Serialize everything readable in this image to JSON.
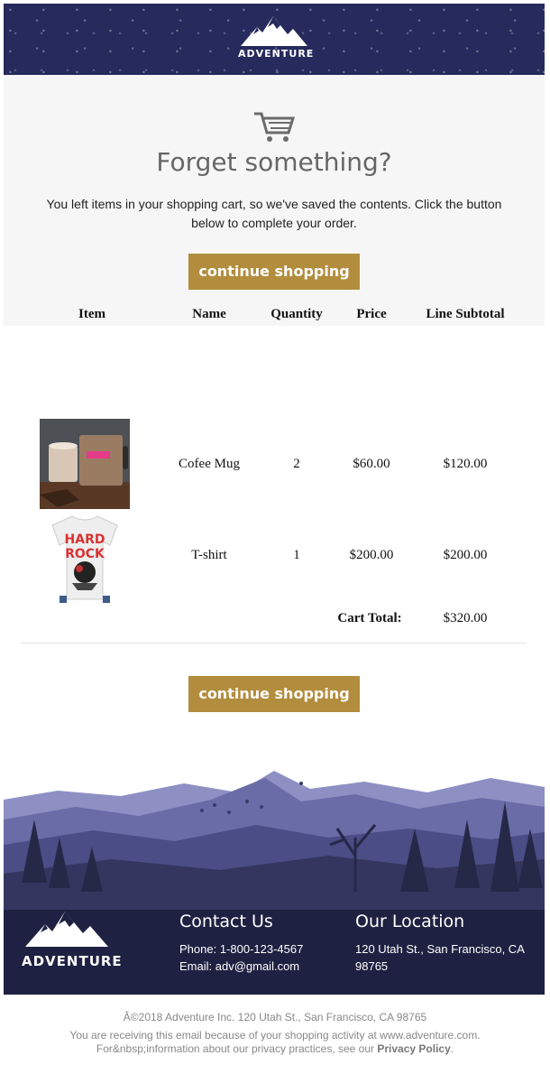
{
  "header": {
    "brand": "ADVENTURE",
    "logo_icon": "mountain-logo-icon"
  },
  "hero": {
    "icon": "shopping-cart-icon",
    "title": "Forget something?",
    "message": "You left items in your shopping cart, so we've saved the contents. Click the button below to complete your order.",
    "button_label": "continue shopping"
  },
  "cart": {
    "columns": [
      "Item",
      "Name",
      "Quantity",
      "Price",
      "Line Subtotal"
    ],
    "rows": [
      {
        "image": "coffee-mug-photo",
        "name": "Cofee Mug",
        "quantity": "2",
        "price": "$60.00",
        "subtotal": "$120.00"
      },
      {
        "image": "tshirt-photo",
        "name": "T-shirt",
        "quantity": "1",
        "price": "$200.00",
        "subtotal": "$200.00"
      }
    ],
    "total_label": "Cart Total:",
    "total_value": "$320.00",
    "button_label": "continue shopping"
  },
  "footer": {
    "brand": "ADVENTURE",
    "contact": {
      "heading": "Contact Us",
      "phone": "Phone: 1-800-123-4567",
      "email": "Email: adv@gmail.com"
    },
    "location": {
      "heading": "Our Location",
      "address": "120 Utah St., San Francisco, CA 98765"
    }
  },
  "legal": {
    "copyright": "Â©2018 Adventure Inc. 120 Utah St., San Francisco, CA 98765",
    "line2": "You are receiving this email because of your shopping activity at www.adventure.com.",
    "line3": "For&nbsp;information about our privacy practices, see our",
    "privacy_link": "Privacy Policy",
    "line3_end": "."
  },
  "colors": {
    "header_bg": "#262a5c",
    "button": "#b38d3e",
    "footer_bg": "#1e2141",
    "hero_bg": "#f6f6f6"
  }
}
